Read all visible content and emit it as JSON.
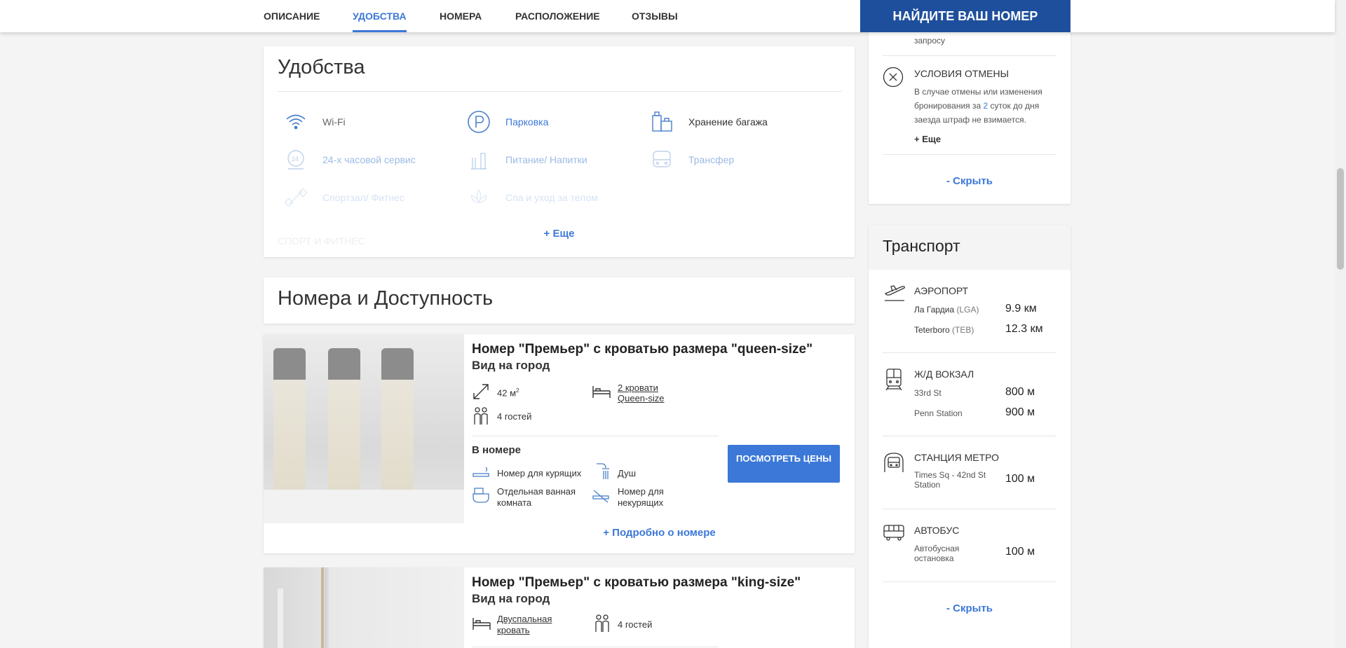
{
  "nav": {
    "tabs": [
      "ОПИСАНИЕ",
      "УДОБСТВА",
      "НОМЕРА",
      "РАСПОЛОЖЕНИЕ",
      "ОТЗЫВЫ"
    ],
    "active_tab": "УДОБСТВА",
    "find_button": "НАЙДИТЕ ВАШ НОМЕР"
  },
  "amenities": {
    "title": "Удобства",
    "items": [
      {
        "label": "Wi-Fi",
        "icon": "wifi-icon"
      },
      {
        "label": "Парковка",
        "icon": "parking-icon"
      },
      {
        "label": "Хранение багажа",
        "icon": "luggage-icon"
      },
      {
        "label": "24-х часовой сервис",
        "icon": "24h-service-icon"
      },
      {
        "label": "Питание/ Напитки",
        "icon": "food-drinks-icon"
      },
      {
        "label": "Трансфер",
        "icon": "shuttle-bus-icon"
      },
      {
        "label": "Спортзал/ Фитнес",
        "icon": "dumbbell-icon"
      },
      {
        "label": "Спа и уход за телом",
        "icon": "spa-icon"
      }
    ],
    "faded_heading": "СПОРТ И ФИТНЕС",
    "more": "+ Еще"
  },
  "rooms": {
    "title": "Номера и Доступность",
    "list": [
      {
        "name": "Номер \"Премьер\" с кроватью размера \"queen-size\"",
        "view": "Вид на город",
        "area": "42 м",
        "area_sup": "2",
        "beds": "2 кровати Queen-size",
        "guests": "4 гостей",
        "in_room_title": "В номере",
        "features": [
          "Номер для курящих",
          "Душ",
          "Отдельная ванная комната",
          "Номер для некурящих"
        ],
        "button": "ПОСМОТРЕТЬ ЦЕНЫ",
        "details": "+ Подробно о номере"
      },
      {
        "name": "Номер \"Премьер\" с кроватью размера \"king-size\"",
        "view": "Вид на город",
        "beds": "Двуспальная кровать",
        "guests": "4 гостей"
      }
    ]
  },
  "policies": {
    "cut_text": "запросу",
    "cancel_title": "УСЛОВИЯ ОТМЕНЫ",
    "cancel_text_1": "В случае отмены или изменения бронирования за ",
    "cancel_text_num": "2",
    "cancel_text_2": " суток до дня заезда штраф не взимается.",
    "more": "+ Еще",
    "hide": "- Скрыть"
  },
  "transport": {
    "title": "Транспорт",
    "groups": [
      {
        "title": "АЭРОПОРТ",
        "icon": "airplane-icon",
        "rows": [
          {
            "name": "Ла Гардиа",
            "code": " (LGA)",
            "dist": "9.9 км"
          },
          {
            "name": "Teterboro",
            "code": " (TEB)",
            "dist": "12.3 км"
          }
        ]
      },
      {
        "title": "Ж/Д ВОКЗАЛ",
        "icon": "train-icon",
        "rows": [
          {
            "name": "33rd St",
            "code": "",
            "dist": "800 м"
          },
          {
            "name": "Penn Station",
            "code": "",
            "dist": "900 м"
          }
        ]
      },
      {
        "title": "СТАНЦИЯ МЕТРО",
        "icon": "metro-icon",
        "rows": [
          {
            "name": "Times Sq - 42nd St Station",
            "code": "",
            "dist": "100 м"
          }
        ]
      },
      {
        "title": "АВТОБУС",
        "icon": "bus-icon",
        "rows": [
          {
            "name": "Автобусная остановка",
            "code": "",
            "dist": "100 м"
          }
        ]
      }
    ],
    "hide": "- Скрыть"
  }
}
